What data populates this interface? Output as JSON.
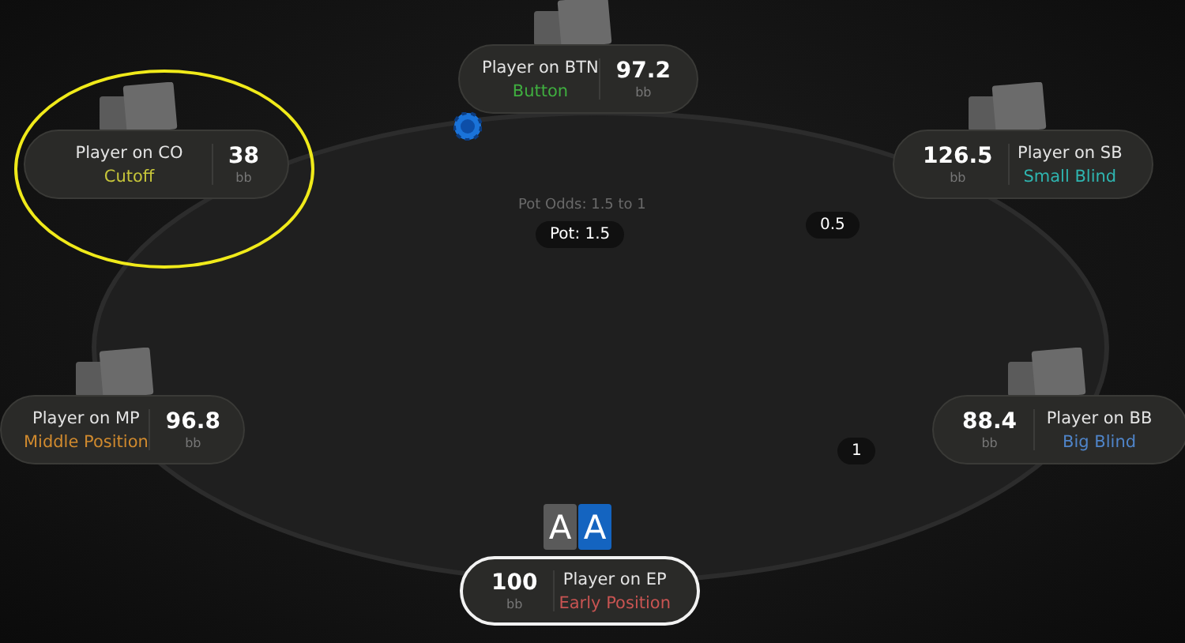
{
  "seats": [
    {
      "name": "Player on BTN",
      "position": "Button",
      "stack": "97.2",
      "unit": "bb",
      "color": "#3fae3f",
      "kind": "name_first",
      "highlighted": false,
      "hero": false
    },
    {
      "name": "Player on CO",
      "position": "Cutoff",
      "stack": "38",
      "unit": "bb",
      "color": "#c7c63a",
      "kind": "name_first",
      "highlighted": true,
      "hero": false
    },
    {
      "name": "Player on SB",
      "position": "Small Blind",
      "stack": "126.5",
      "unit": "bb",
      "color": "#2fb5b0",
      "kind": "stack_first",
      "highlighted": false,
      "hero": false
    },
    {
      "name": "Player on MP",
      "position": "Middle Position",
      "stack": "96.8",
      "unit": "bb",
      "color": "#d08a2e",
      "kind": "name_first",
      "highlighted": false,
      "hero": false
    },
    {
      "name": "Player on BB",
      "position": "Big Blind",
      "stack": "88.4",
      "unit": "bb",
      "color": "#4f84c8",
      "kind": "stack_first",
      "highlighted": false,
      "hero": false
    },
    {
      "name": "Player on EP",
      "position": "Early Position",
      "stack": "100",
      "unit": "bb",
      "color": "#c85452",
      "kind": "stack_first",
      "highlighted": false,
      "hero": true
    }
  ],
  "pot_odds": "Pot Odds: 1.5 to 1",
  "pot": "Pot: 1.5",
  "bets": [
    "0.5",
    "1"
  ],
  "hero_cards": [
    {
      "rank": "A",
      "color": "#5a5a5a"
    },
    {
      "rank": "A",
      "color": "#1464c0"
    }
  ]
}
